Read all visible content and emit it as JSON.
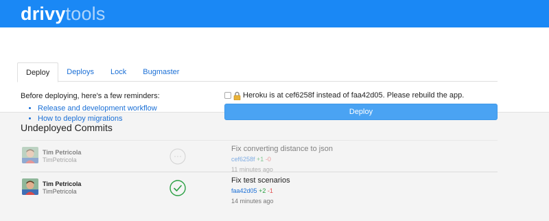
{
  "brand": {
    "name": "drivy",
    "suffix": "tools"
  },
  "tabs": [
    {
      "label": "Deploy",
      "active": true
    },
    {
      "label": "Deploys",
      "active": false
    },
    {
      "label": "Lock",
      "active": false
    },
    {
      "label": "Bugmaster",
      "active": false
    }
  ],
  "reminders": {
    "intro": "Before deploying, here's a few reminders:",
    "links": [
      "Release and development workflow",
      "How to deploy migrations"
    ]
  },
  "warning": {
    "text": "Heroku is at cef6258f instead of faa42d05. Please rebuild the app.",
    "checked": false
  },
  "deploy_button": "Deploy",
  "commits_section": {
    "title": "Undeployed Commits",
    "commits": [
      {
        "author": "Tim Petricola",
        "handle": "TimPetricola",
        "status": "pending",
        "message": "Fix converting distance to json",
        "sha": "cef6258f",
        "additions": "+1",
        "deletions": "-0",
        "time": "11 minutes ago"
      },
      {
        "author": "Tim Petricola",
        "handle": "TimPetricola",
        "status": "success",
        "message": "Fix test scenarios",
        "sha": "faa42d05",
        "additions": "+2",
        "deletions": "-1",
        "time": "14 minutes ago"
      }
    ]
  },
  "colors": {
    "header": "#1a88f5",
    "link": "#1a6fd6",
    "button": "#4aa3f3",
    "success": "#2aa043",
    "deletion": "#e05252"
  }
}
